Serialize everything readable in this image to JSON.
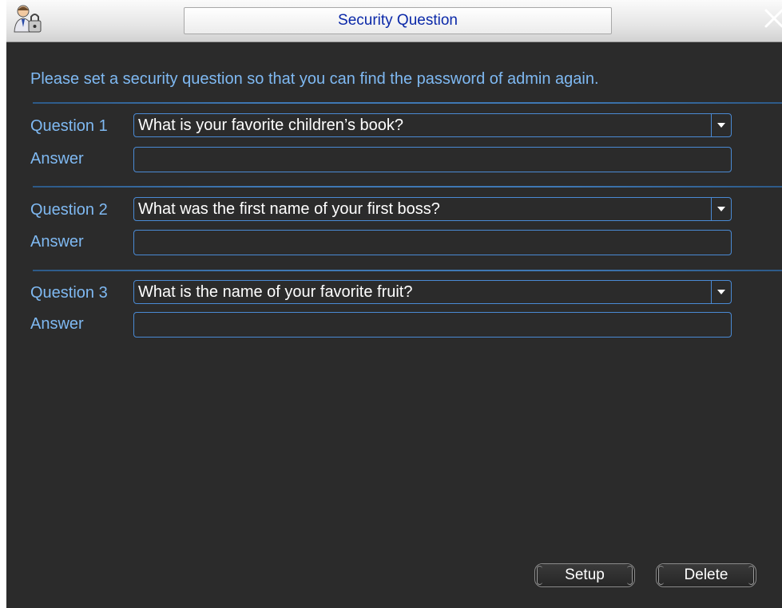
{
  "window": {
    "title": "Security Question",
    "app_icon": "admin-lock-icon",
    "close_icon": "close-icon"
  },
  "info_text": "Please set a security question so that you can find the password of admin again.",
  "questions": [
    {
      "label": "Question 1",
      "selected": "What is your favorite children’s book?",
      "answer_label": "Answer",
      "answer_value": ""
    },
    {
      "label": "Question 2",
      "selected": "What was the first name of your first boss?",
      "answer_label": "Answer",
      "answer_value": ""
    },
    {
      "label": "Question 3",
      "selected": "What is the name of your favorite fruit?",
      "answer_label": "Answer",
      "answer_value": ""
    }
  ],
  "buttons": {
    "setup": "Setup",
    "delete": "Delete"
  },
  "colors": {
    "background": "#2b2b2b",
    "label_text": "#7fb9f2",
    "title_text": "#0a28a8",
    "field_border": "#4a8ad4"
  }
}
